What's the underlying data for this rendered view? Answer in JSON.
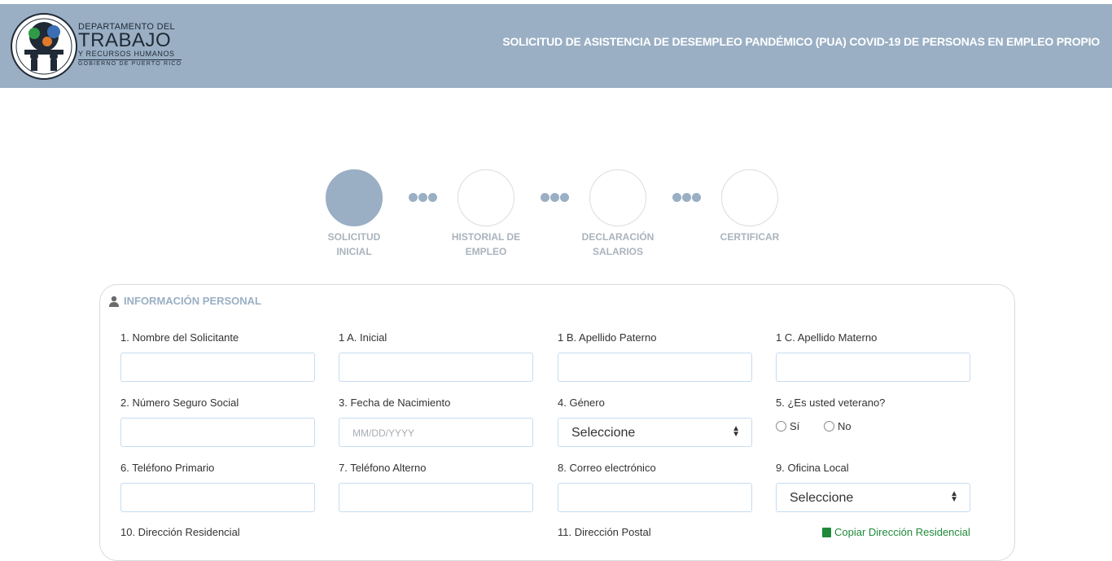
{
  "header": {
    "logo_line1": "DEPARTAMENTO DEL",
    "logo_line2": "TRABAJO",
    "logo_line3": "Y RECURSOS HUMANOS",
    "logo_line4": "GOBIERNO DE PUERTO RICO",
    "title": "SOLICITUD DE ASISTENCIA DE DESEMPLEO PANDÉMICO (PUA) COVID-19 DE PERSONAS EN EMPLEO PROPIO",
    "background_color": "#9aafc4"
  },
  "stepper": {
    "steps": [
      {
        "line1": "SOLICITUD",
        "line2": "INICIAL",
        "active": true
      },
      {
        "line1": "HISTORIAL DE",
        "line2": "EMPLEO",
        "active": false
      },
      {
        "line1": "DECLARACIÓN",
        "line2": "SALARIOS",
        "active": false
      },
      {
        "line1": "CERTIFICAR",
        "line2": "",
        "active": false
      }
    ],
    "active_color": "#9aafc4"
  },
  "section": {
    "title": "INFORMACIÓN PERSONAL",
    "icon": "person-icon"
  },
  "form": {
    "first_name_label": "1. Nombre del Solicitante",
    "initial_label": "1 A. Inicial",
    "paternal_label": "1 B. Apellido Paterno",
    "maternal_label": "1 C. Apellido Materno",
    "ssn_label": "2. Número Seguro Social",
    "dob_label": "3. Fecha de Nacimiento",
    "dob_placeholder": "MM/DD/YYYY",
    "gender_label": "4. Género",
    "gender_value": "Seleccione",
    "veteran_label": "5. ¿Es usted veterano?",
    "veteran_yes": "Sí",
    "veteran_no": "No",
    "phone_label": "6. Teléfono Primario",
    "alt_phone_label": "7. Teléfono Alterno",
    "email_label": "8. Correo electrónico",
    "office_label": "9. Oficina Local",
    "office_value": "Seleccione",
    "residential_label": "10. Dirección Residencial",
    "postal_label": "11. Dirección Postal",
    "copy_address_link": "Copiar Dirección Residencial"
  }
}
